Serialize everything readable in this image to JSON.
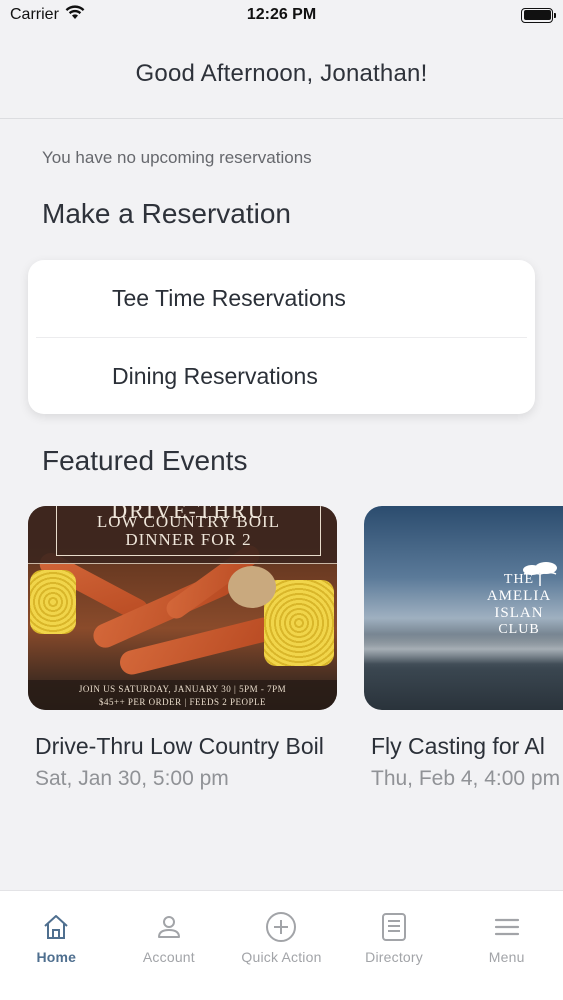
{
  "status_bar": {
    "carrier": "Carrier",
    "time": "12:26 PM"
  },
  "header": {
    "greeting": "Good Afternoon, Jonathan!"
  },
  "reservations": {
    "empty_message": "You have no upcoming reservations"
  },
  "make_reservation": {
    "title": "Make a Reservation",
    "items": [
      {
        "label": "Tee Time Reservations"
      },
      {
        "label": "Dining Reservations"
      }
    ]
  },
  "featured_events": {
    "title": "Featured Events",
    "events": [
      {
        "title": "Drive-Thru Low Country Boil",
        "date": "Sat, Jan 30, 5:00 pm",
        "image_text": {
          "headline": "DRIVE-THRU",
          "line1": "LOW COUNTRY BOIL",
          "line2": "DINNER FOR 2",
          "footer1": "JOIN US SATURDAY, JANUARY 30 | 5PM - 7PM",
          "footer2": "$45++ PER ORDER | FEEDS 2 PEOPLE"
        }
      },
      {
        "title": "Fly Casting for Al",
        "date": "Thu, Feb 4, 4:00 pm",
        "image_text": {
          "logo_line1": "THE",
          "logo_line2": "AMELIA ISLAN",
          "logo_line3": "CLUB"
        }
      }
    ]
  },
  "tab_bar": {
    "tabs": [
      {
        "label": "Home",
        "icon": "home-icon",
        "active": true
      },
      {
        "label": "Account",
        "icon": "account-icon",
        "active": false
      },
      {
        "label": "Quick Action",
        "icon": "plus-circle-icon",
        "active": false
      },
      {
        "label": "Directory",
        "icon": "directory-icon",
        "active": false
      },
      {
        "label": "Menu",
        "icon": "menu-icon",
        "active": false
      }
    ]
  },
  "colors": {
    "background": "#f2f2f4",
    "active_tab": "#4f6f8f",
    "inactive_tab": "#a2a4a8",
    "text_primary": "#2b3038",
    "text_secondary": "#909296"
  }
}
